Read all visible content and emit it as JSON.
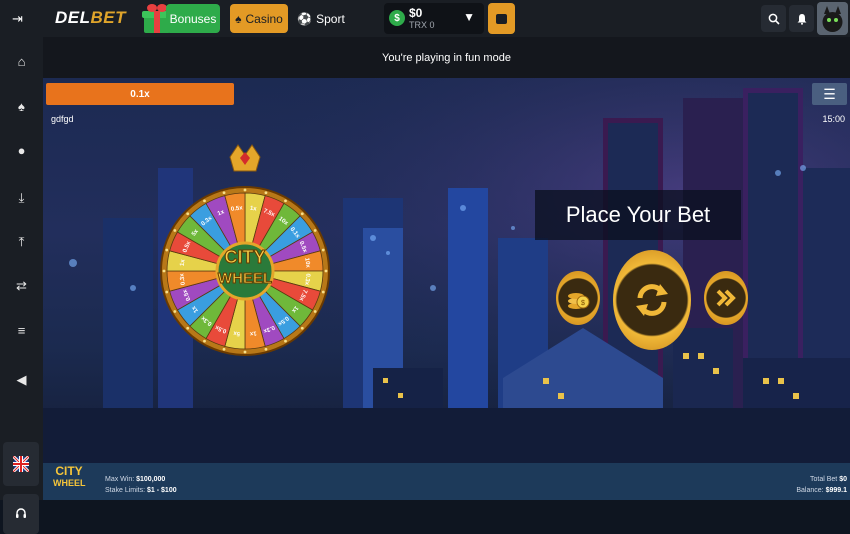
{
  "header": {
    "logo_prefix": "DEL",
    "logo_suffix": "BET",
    "bonuses_label": "Bonuses",
    "casino_label": "Casino",
    "sport_label": "Sport",
    "wallet": {
      "amount": "$0",
      "sub": "TRX 0",
      "currency_icon": "$"
    }
  },
  "sidebar": {
    "items": [
      "expand-icon",
      "home-icon",
      "spade-icon",
      "basketball-icon",
      "download-icon",
      "upload-icon",
      "transfer-icon",
      "coins-icon",
      "megaphone-icon",
      "uk-flag-icon",
      "support-icon"
    ]
  },
  "banner": {
    "text": "You're playing in fun mode"
  },
  "game": {
    "multiplier_bar": "0.1x",
    "name": "gdfgd",
    "time": "15:00",
    "wheel_title_1": "CITY",
    "wheel_title_2": "WHEEL",
    "place_bet": "Place Your Bet",
    "segments": [
      "1x",
      "7.5x",
      "10x",
      "0.1x",
      "0.5x",
      "10x",
      "0.3x",
      "7.5x",
      "1x",
      "0.5x",
      "0.3x",
      "1x",
      "5x",
      "0.5x",
      "0.3x",
      "1x",
      "0.5x",
      "0.3x",
      "1x",
      "0.5x",
      "5x",
      "0.3x",
      "1x",
      "0.5x"
    ]
  },
  "footer": {
    "logo_1": "CITY",
    "logo_2": "WHEEL",
    "max_win_label": "Max Win:",
    "max_win_value": "$100,000",
    "stake_label": "Stake Limits:",
    "stake_value": "$1 - $100",
    "total_bet_label": "Total Bet",
    "total_bet_value": "$0",
    "balance_label": "Balance:",
    "balance_value": "$999.1"
  }
}
